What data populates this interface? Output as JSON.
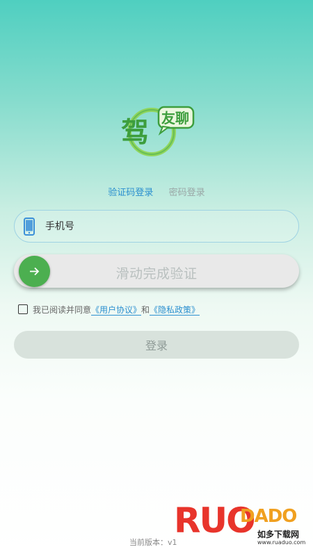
{
  "logo": {
    "main_text": "驾",
    "bubble_text": "友聊"
  },
  "tabs": [
    {
      "label": "验证码登录",
      "active": true
    },
    {
      "label": "密码登录",
      "active": false
    }
  ],
  "phone": {
    "placeholder": "手机号",
    "value": ""
  },
  "slider": {
    "label": "滑动完成验证",
    "handle_icon": "arrow-right-icon"
  },
  "agreement": {
    "checked": false,
    "prefix": "我已阅读并同意",
    "user_agreement": "《用户协议》",
    "and": "和",
    "privacy_policy": "《隐私政策》"
  },
  "login_button": {
    "label": "登录"
  },
  "version": {
    "label": "当前版本：v1"
  },
  "watermark": {
    "brand_a": "RUO",
    "brand_b": "DADO",
    "sub": "如多下载网",
    "url": "www.ruaduo.com"
  },
  "colors": {
    "accent": "#2a8fcf",
    "slider_handle": "#4caf50",
    "border": "#9ed2e3",
    "login_bg": "#d8e2dc"
  }
}
